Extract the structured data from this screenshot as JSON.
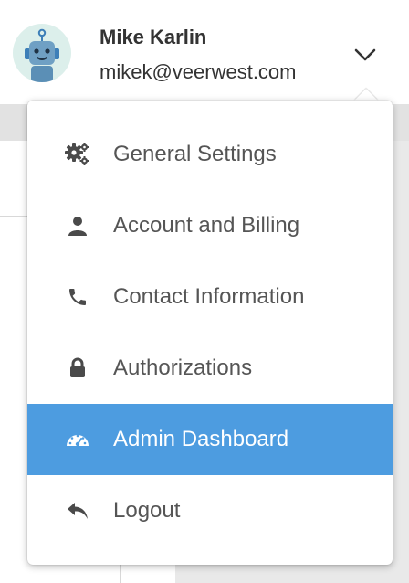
{
  "user": {
    "name": "Mike Karlin",
    "email": "mikek@veerwest.com"
  },
  "menu": {
    "items": [
      {
        "label": "General Settings",
        "icon": "gears-icon",
        "active": false
      },
      {
        "label": "Account and Billing",
        "icon": "user-icon",
        "active": false
      },
      {
        "label": "Contact Information",
        "icon": "phone-icon",
        "active": false
      },
      {
        "label": "Authorizations",
        "icon": "lock-icon",
        "active": false
      },
      {
        "label": "Admin Dashboard",
        "icon": "dashboard-gauge-icon",
        "active": true
      },
      {
        "label": "Logout",
        "icon": "reply-arrow-icon",
        "active": false
      }
    ]
  },
  "colors": {
    "active_item_bg": "#4d9ce0",
    "avatar_bg": "#dcefeb",
    "robot_body": "#6fa0c4"
  }
}
